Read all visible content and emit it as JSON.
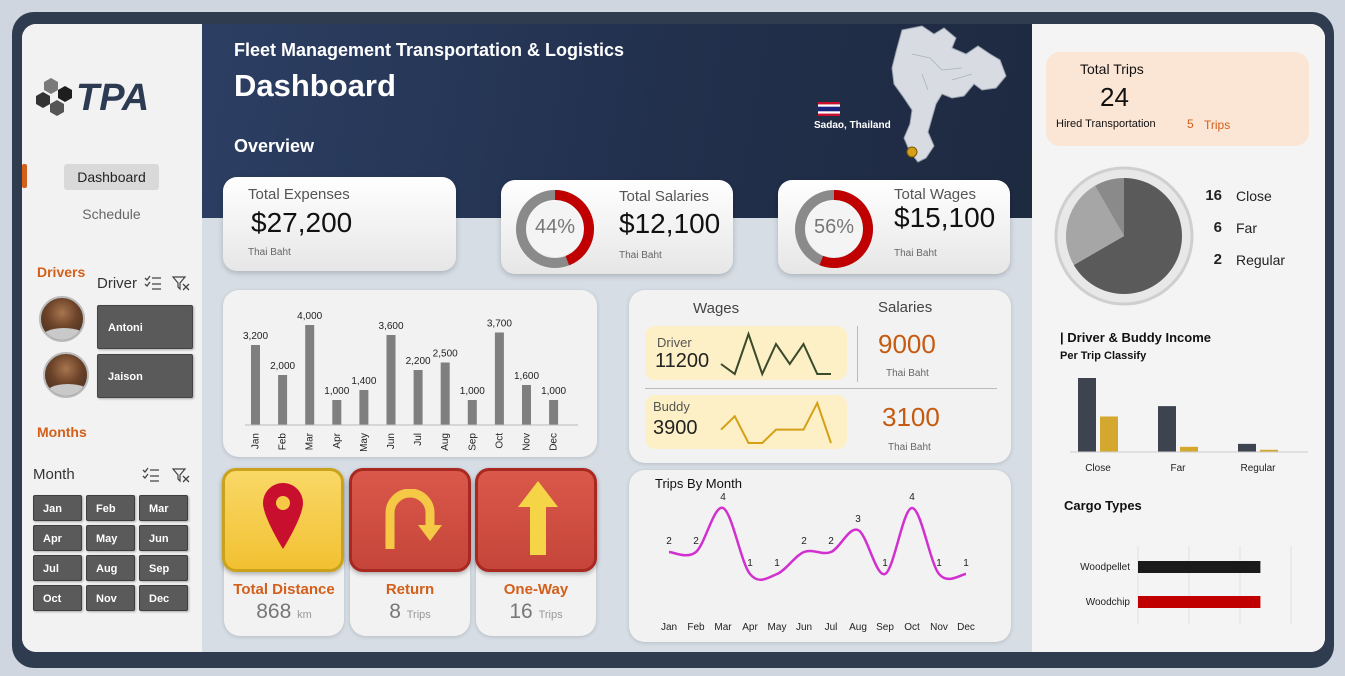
{
  "brand": {
    "logo_text": "TPA"
  },
  "nav": {
    "dashboard": "Dashboard",
    "schedule": "Schedule"
  },
  "drivers": {
    "section_title": "Drivers",
    "slicer_label": "Driver",
    "items": [
      "Antoni",
      "Jaison"
    ]
  },
  "months": {
    "section_title": "Months",
    "slicer_label": "Month",
    "items": [
      "Jan",
      "Feb",
      "Mar",
      "Apr",
      "May",
      "Jun",
      "Jul",
      "Aug",
      "Sep",
      "Oct",
      "Nov",
      "Dec"
    ]
  },
  "header": {
    "subtitle": "Fleet Management Transportation & Logistics",
    "title": "Dashboard",
    "overview": "Overview",
    "location": "Sadao, Thailand"
  },
  "kpis": {
    "expenses": {
      "title": "Total Expenses",
      "value": "$27,200",
      "unit": "Thai Baht"
    },
    "salaries": {
      "title": "Total Salaries",
      "value": "$12,100",
      "unit": "Thai Baht",
      "percent_label": "44%",
      "percent": 44
    },
    "wages": {
      "title": "Total Wages",
      "value": "$15,100",
      "unit": "Thai Baht",
      "percent_label": "56%",
      "percent": 56
    }
  },
  "wages_salaries": {
    "wages_header": "Wages",
    "salaries_header": "Salaries",
    "driver": {
      "label": "Driver",
      "wage": "11200",
      "salary": "9000",
      "unit": "Thai Baht",
      "spark": [
        2,
        1,
        5,
        1,
        4,
        2,
        4,
        1,
        1
      ]
    },
    "buddy": {
      "label": "Buddy",
      "wage": "3900",
      "salary": "3100",
      "unit": "Thai Baht",
      "spark": [
        2,
        3,
        1,
        1,
        2,
        2,
        2,
        4,
        1
      ]
    }
  },
  "actions": {
    "distance": {
      "label": "Total Distance",
      "value": "868",
      "unit": "km"
    },
    "return": {
      "label": "Return",
      "value": "8",
      "unit": "Trips"
    },
    "oneway": {
      "label": "One-Way",
      "value": "16",
      "unit": "Trips"
    }
  },
  "trips_summary": {
    "title": "Total Trips",
    "value": "24",
    "hired_label": "Hired Transportation",
    "hired_value": "5",
    "hired_unit": "Trips"
  },
  "distance_classes": [
    {
      "count": "16",
      "label": "Close",
      "value": 16,
      "color": "#5a5a5a"
    },
    {
      "count": "6",
      "label": "Far",
      "value": 6,
      "color": "#a6a6a6"
    },
    {
      "count": "2",
      "label": "Regular",
      "value": 2,
      "color": "#8a8a8a"
    }
  ],
  "colors": {
    "accent_orange": "#d35f1a",
    "red": "#c00000",
    "dark": "#3d4450",
    "gold": "#d4a82e"
  },
  "chart_data": [
    {
      "type": "bar",
      "title": "",
      "categories": [
        "Jan",
        "Feb",
        "Mar",
        "Apr",
        "May",
        "Jun",
        "Jul",
        "Aug",
        "Sep",
        "Oct",
        "Nov",
        "Dec"
      ],
      "values": [
        3200,
        2000,
        4000,
        1000,
        1400,
        3600,
        2200,
        2500,
        1000,
        3700,
        1600,
        1000
      ],
      "data_labels": [
        "3,200",
        "2,000",
        "4,000",
        "1,000",
        "1,400",
        "3,600",
        "2,200",
        "2,500",
        "1,000",
        "3,700",
        "1,600",
        "1,000"
      ],
      "ylim": [
        0,
        4000
      ]
    },
    {
      "type": "line",
      "title": "Trips By Month",
      "categories": [
        "Jan",
        "Feb",
        "Mar",
        "Apr",
        "May",
        "Jun",
        "Jul",
        "Aug",
        "Sep",
        "Oct",
        "Nov",
        "Dec"
      ],
      "values": [
        2,
        2,
        4,
        1,
        1,
        2,
        2,
        3,
        1,
        4,
        1,
        1
      ],
      "ylim": [
        0,
        4
      ]
    },
    {
      "type": "pie",
      "categories": [
        "Close",
        "Far",
        "Regular"
      ],
      "values": [
        16,
        6,
        2
      ]
    },
    {
      "type": "bar",
      "title": "| Driver & Buddy Income",
      "subtitle": "Per Trip Classify",
      "categories": [
        "Close",
        "Far",
        "Regular"
      ],
      "series": [
        {
          "values": [
            100,
            62,
            11
          ]
        },
        {
          "values": [
            48,
            7,
            3
          ]
        }
      ]
    },
    {
      "type": "bar",
      "orientation": "horizontal",
      "title": "Cargo Types",
      "categories": [
        "Woodpellet",
        "Woodchip"
      ],
      "values": [
        12,
        12
      ],
      "xlim": [
        0,
        15
      ],
      "xticks": [
        "0",
        "5",
        "10",
        "15"
      ]
    }
  ]
}
